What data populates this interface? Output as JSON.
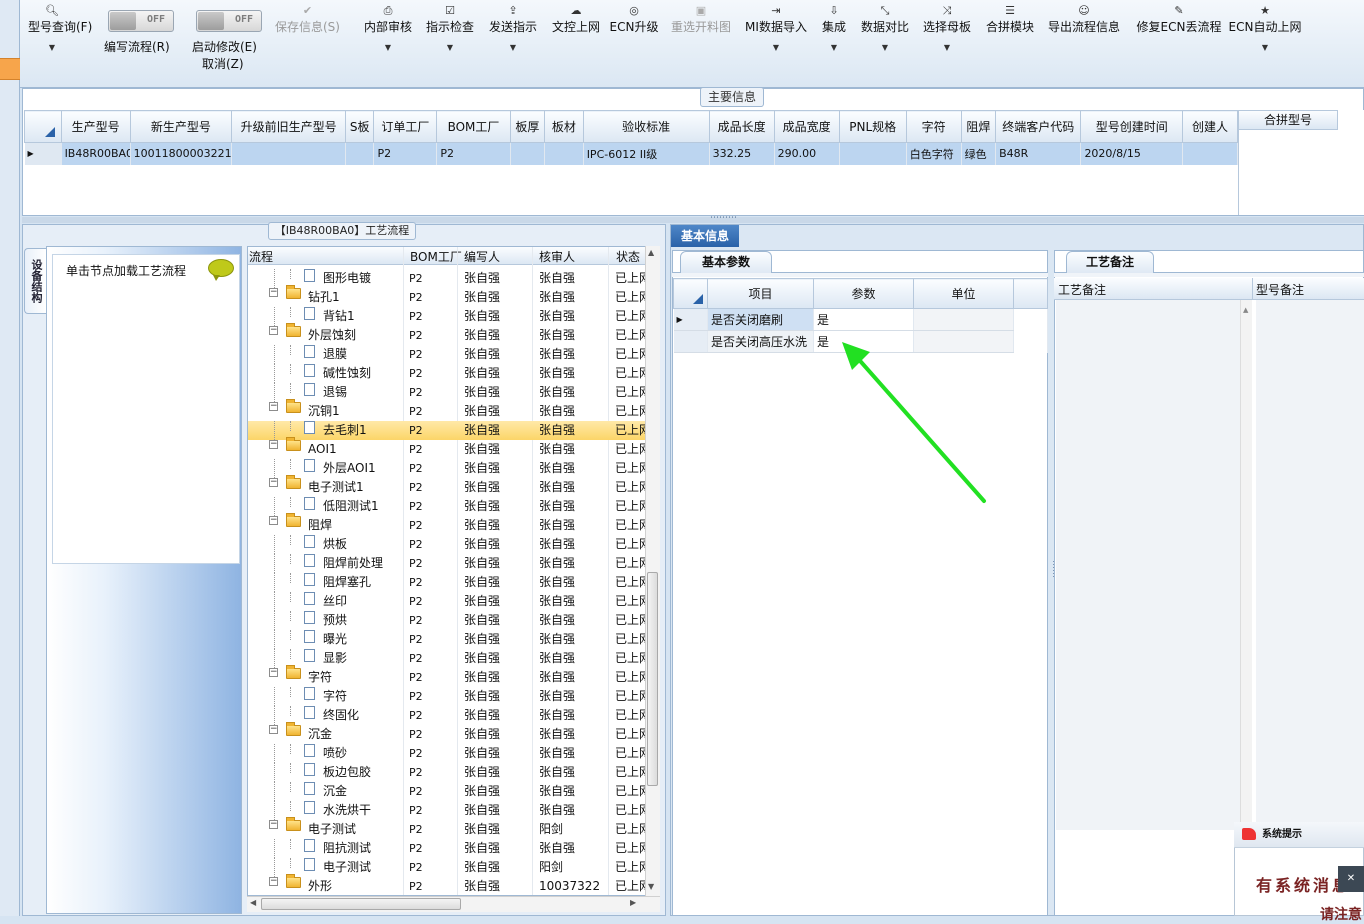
{
  "toolbar": {
    "buttons": [
      {
        "label": "型号查询(F)",
        "icon": "search-icon"
      },
      {
        "label": "保存信息(S)",
        "icon": "check-icon"
      },
      {
        "label": "内部审核",
        "icon": "printer-icon"
      },
      {
        "label": "指示检查",
        "icon": "checkbox-icon"
      },
      {
        "label": "发送指示",
        "icon": "upload-icon"
      },
      {
        "label": "文控上网",
        "icon": "cloud-upload-icon"
      },
      {
        "label": "ECN升级",
        "icon": "binoculars-icon"
      },
      {
        "label": "重选开料图",
        "icon": "image-icon"
      },
      {
        "label": "MI数据导入",
        "icon": "sign-in-icon"
      },
      {
        "label": "集成",
        "icon": "download-icon"
      },
      {
        "label": "数据对比",
        "icon": "compress-icon"
      },
      {
        "label": "选择母板",
        "icon": "shuffle-icon"
      },
      {
        "label": "合拼模块",
        "icon": "list-icon"
      },
      {
        "label": "导出流程信息",
        "icon": "smile-icon"
      },
      {
        "label": "修复ECN丢流程",
        "icon": "wrench-icon"
      },
      {
        "label": "ECN自动上网",
        "icon": "star-icon"
      }
    ],
    "toggles": [
      {
        "label": "编写流程(R)",
        "state": "OFF"
      },
      {
        "label": "启动修改(E)",
        "state": "OFF",
        "sublabel": "取消(Z)"
      }
    ]
  },
  "main_info": {
    "caption": "主要信息",
    "columns": [
      "生产型号",
      "新生产型号",
      "升级前旧生产型号",
      "S板",
      "订单工厂",
      "BOM工厂",
      "板厚",
      "板材",
      "验收标准",
      "成品长度",
      "成品宽度",
      "PNL规格",
      "字符",
      "阻焊",
      "终端客户代码",
      "型号创建时间",
      "创建人"
    ],
    "row": [
      "IB48R00BA0",
      "10011800003221",
      "",
      "",
      "P2",
      "P2",
      "",
      "",
      "IPC-6012 II级",
      "332.25",
      "290.00",
      "",
      "白色字符",
      "绿色",
      "B48R",
      "2020/8/15",
      ""
    ],
    "merge_header": "合拼型号"
  },
  "process": {
    "caption": "【IB48R00BA0】工艺流程",
    "side_tab": "设备结构",
    "load_hint": "单击节点加载工艺流程",
    "columns": [
      "流程",
      "BOM工厂",
      "编写人",
      "核审人",
      "状态"
    ],
    "rows": [
      {
        "name": "图形电镀",
        "level": 1,
        "bom": "P2",
        "writer": "张自强",
        "reviewer": "张自强",
        "status": "已上网"
      },
      {
        "name": "钻孔1",
        "level": 0,
        "bom": "P2",
        "writer": "张自强",
        "reviewer": "张自强",
        "status": "已上网"
      },
      {
        "name": "背钻1",
        "level": 1,
        "bom": "P2",
        "writer": "张自强",
        "reviewer": "张自强",
        "status": "已上网"
      },
      {
        "name": "外层蚀刻",
        "level": 0,
        "bom": "P2",
        "writer": "张自强",
        "reviewer": "张自强",
        "status": "已上网"
      },
      {
        "name": "退膜",
        "level": 1,
        "bom": "P2",
        "writer": "张自强",
        "reviewer": "张自强",
        "status": "已上网"
      },
      {
        "name": "碱性蚀刻",
        "level": 1,
        "bom": "P2",
        "writer": "张自强",
        "reviewer": "张自强",
        "status": "已上网"
      },
      {
        "name": "退锡",
        "level": 1,
        "bom": "P2",
        "writer": "张自强",
        "reviewer": "张自强",
        "status": "已上网"
      },
      {
        "name": "沉铜1",
        "level": 0,
        "bom": "P2",
        "writer": "张自强",
        "reviewer": "张自强",
        "status": "已上网"
      },
      {
        "name": "去毛刺1",
        "level": 1,
        "bom": "P2",
        "writer": "张自强",
        "reviewer": "张自强",
        "status": "已上网",
        "selected": true
      },
      {
        "name": "AOI1",
        "level": 0,
        "bom": "P2",
        "writer": "张自强",
        "reviewer": "张自强",
        "status": "已上网"
      },
      {
        "name": "外层AOI1",
        "level": 1,
        "bom": "P2",
        "writer": "张自强",
        "reviewer": "张自强",
        "status": "已上网"
      },
      {
        "name": "电子测试1",
        "level": 0,
        "bom": "P2",
        "writer": "张自强",
        "reviewer": "张自强",
        "status": "已上网"
      },
      {
        "name": "低阻测试1",
        "level": 1,
        "bom": "P2",
        "writer": "张自强",
        "reviewer": "张自强",
        "status": "已上网"
      },
      {
        "name": "阻焊",
        "level": 0,
        "bom": "P2",
        "writer": "张自强",
        "reviewer": "张自强",
        "status": "已上网"
      },
      {
        "name": "烘板",
        "level": 1,
        "bom": "P2",
        "writer": "张自强",
        "reviewer": "张自强",
        "status": "已上网"
      },
      {
        "name": "阻焊前处理",
        "level": 1,
        "bom": "P2",
        "writer": "张自强",
        "reviewer": "张自强",
        "status": "已上网"
      },
      {
        "name": "阻焊塞孔",
        "level": 1,
        "bom": "P2",
        "writer": "张自强",
        "reviewer": "张自强",
        "status": "已上网"
      },
      {
        "name": "丝印",
        "level": 1,
        "bom": "P2",
        "writer": "张自强",
        "reviewer": "张自强",
        "status": "已上网"
      },
      {
        "name": "预烘",
        "level": 1,
        "bom": "P2",
        "writer": "张自强",
        "reviewer": "张自强",
        "status": "已上网"
      },
      {
        "name": "曝光",
        "level": 1,
        "bom": "P2",
        "writer": "张自强",
        "reviewer": "张自强",
        "status": "已上网"
      },
      {
        "name": "显影",
        "level": 1,
        "bom": "P2",
        "writer": "张自强",
        "reviewer": "张自强",
        "status": "已上网"
      },
      {
        "name": "字符",
        "level": 0,
        "bom": "P2",
        "writer": "张自强",
        "reviewer": "张自强",
        "status": "已上网"
      },
      {
        "name": "字符",
        "level": 1,
        "bom": "P2",
        "writer": "张自强",
        "reviewer": "张自强",
        "status": "已上网"
      },
      {
        "name": "终固化",
        "level": 1,
        "bom": "P2",
        "writer": "张自强",
        "reviewer": "张自强",
        "status": "已上网"
      },
      {
        "name": "沉金",
        "level": 0,
        "bom": "P2",
        "writer": "张自强",
        "reviewer": "张自强",
        "status": "已上网"
      },
      {
        "name": "喷砂",
        "level": 1,
        "bom": "P2",
        "writer": "张自强",
        "reviewer": "张自强",
        "status": "已上网"
      },
      {
        "name": "板边包胶",
        "level": 1,
        "bom": "P2",
        "writer": "张自强",
        "reviewer": "张自强",
        "status": "已上网"
      },
      {
        "name": "沉金",
        "level": 1,
        "bom": "P2",
        "writer": "张自强",
        "reviewer": "张自强",
        "status": "已上网"
      },
      {
        "name": "水洗烘干",
        "level": 1,
        "bom": "P2",
        "writer": "张自强",
        "reviewer": "张自强",
        "status": "已上网"
      },
      {
        "name": "电子测试",
        "level": 0,
        "bom": "P2",
        "writer": "张自强",
        "reviewer": "阳剑",
        "status": "已上网"
      },
      {
        "name": "阻抗测试",
        "level": 1,
        "bom": "P2",
        "writer": "张自强",
        "reviewer": "张自强",
        "status": "已上网"
      },
      {
        "name": "电子测试",
        "level": 1,
        "bom": "P2",
        "writer": "张自强",
        "reviewer": "阳剑",
        "status": "已上网"
      },
      {
        "name": "外形",
        "level": 0,
        "bom": "P2",
        "writer": "张自强",
        "reviewer": "10037322",
        "status": "已上网"
      }
    ]
  },
  "basic_info": {
    "tab": "基本信息",
    "params_tab": "基本参数",
    "columns": [
      "项目",
      "参数",
      "单位"
    ],
    "rows": [
      {
        "item": "是否关闭磨刷",
        "value": "是",
        "unit": ""
      },
      {
        "item": "是否关闭高压水洗",
        "value": "是",
        "unit": ""
      }
    ]
  },
  "notes": {
    "tab": "工艺备注",
    "columns": [
      "工艺备注",
      "型号备注"
    ]
  },
  "popup": {
    "title": "系统提示",
    "message": "有系统消息",
    "message2": "请注意"
  },
  "colors": {
    "arrow": "#22e022",
    "selected_row": "#fcd568",
    "accent": "#2a62a8"
  }
}
